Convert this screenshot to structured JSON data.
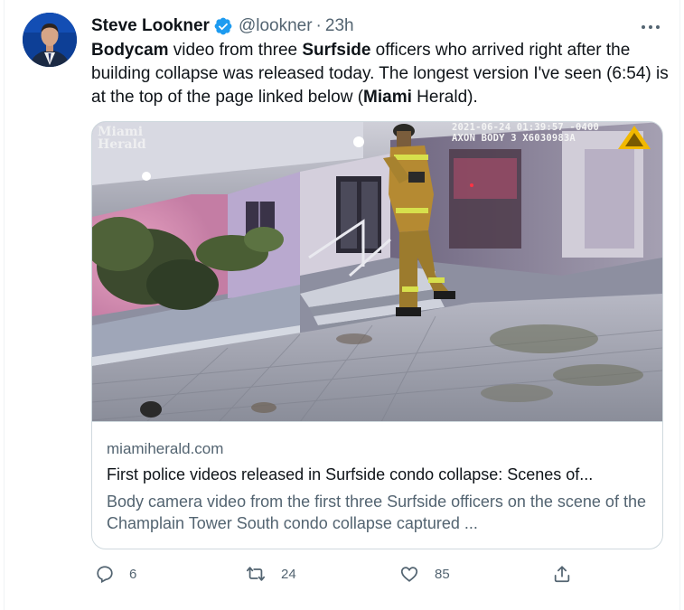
{
  "author": {
    "name": "Steve Lookner",
    "handle": "@lookner",
    "separator": "·",
    "time": "23h",
    "verified": true,
    "avatar_icon": "avatar-icon"
  },
  "tweet": {
    "segments": [
      {
        "text": "Bodycam",
        "bold": true
      },
      {
        "text": " video from three ",
        "bold": false
      },
      {
        "text": "Surfside",
        "bold": true
      },
      {
        "text": " officers who arrived  right after the building collapse was released today. The longest version I've seen (6:54) is at the top of the page linked below (",
        "bold": false
      },
      {
        "text": "Miami",
        "bold": true
      },
      {
        "text": " Herald).",
        "bold": false
      }
    ]
  },
  "card": {
    "watermark_line1": "Miami",
    "watermark_line2": "Herald",
    "stamp_line1": "2021-06-24 01:39:57 -0400",
    "stamp_line2": "AXON BODY 3 X6030983A",
    "domain": "miamiherald.com",
    "title": "First police videos released in Surfside condo collapse: Scenes of...",
    "description": "Body camera video from the first three Surfside officers on the scene of the Champlain Tower South condo collapse captured ..."
  },
  "actions": {
    "reply": {
      "icon": "reply-icon",
      "count": "6"
    },
    "retweet": {
      "icon": "retweet-icon",
      "count": "24"
    },
    "like": {
      "icon": "like-icon",
      "count": "85"
    },
    "share": {
      "icon": "share-icon"
    }
  },
  "colors": {
    "text": "#0f1419",
    "secondary": "#536471",
    "verified": "#1d9bf0",
    "border": "#cfd9de"
  }
}
